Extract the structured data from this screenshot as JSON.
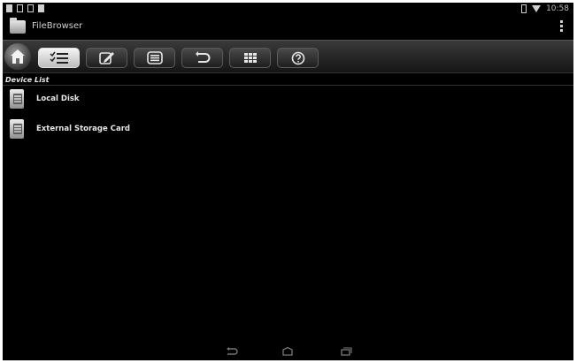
{
  "status_bar": {
    "time": "10:58",
    "colors": {
      "icon": "#cfcfcf"
    }
  },
  "app_bar": {
    "title": "FileBrowser"
  },
  "toolbar": {
    "buttons": [
      {
        "name": "home-icon"
      },
      {
        "name": "checklist-icon",
        "active": true
      },
      {
        "name": "edit-icon"
      },
      {
        "name": "list-icon"
      },
      {
        "name": "undo-icon"
      },
      {
        "name": "grid-icon"
      },
      {
        "name": "help-icon"
      }
    ]
  },
  "device_list": {
    "label": "Device List",
    "items": [
      {
        "label": "Local Disk",
        "icon": "disk-icon"
      },
      {
        "label": "External Storage Card",
        "icon": "sd-card-icon"
      }
    ]
  },
  "nav_bar": {
    "icons": [
      "back-icon",
      "home-nav-icon",
      "recents-icon"
    ]
  },
  "colors": {
    "background": "#000000",
    "text": "#e6e6e6",
    "toolbar_active": "#e6e6e6"
  }
}
